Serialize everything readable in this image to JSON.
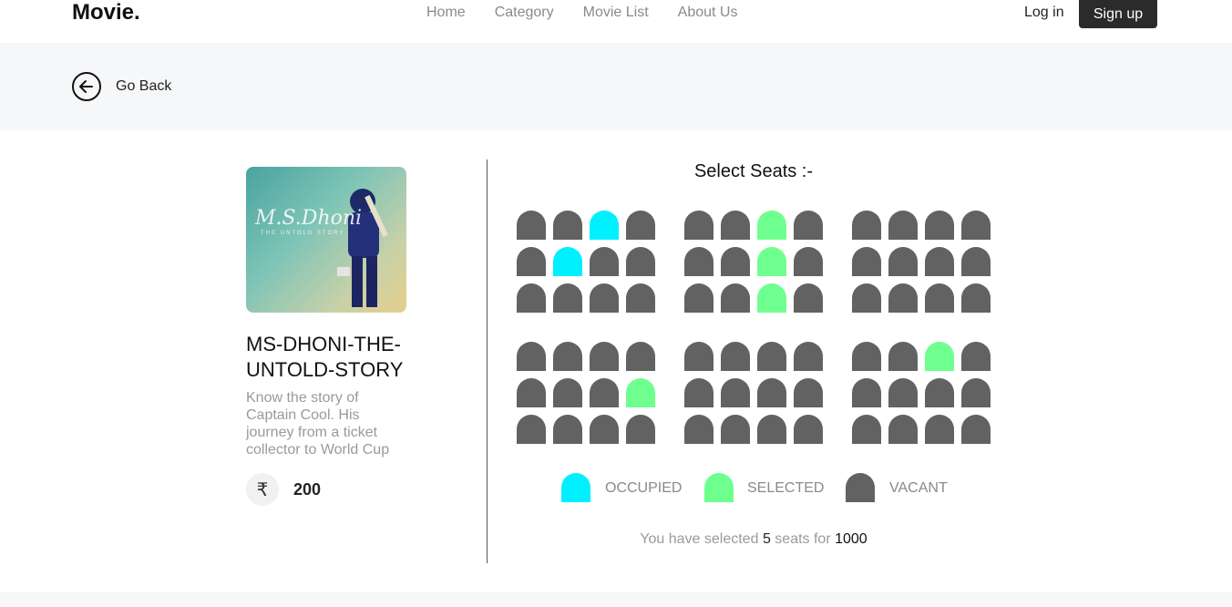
{
  "navbar": {
    "brand": "Movie.",
    "links": [
      "Home",
      "Category",
      "Movie List",
      "About Us"
    ],
    "login": "Log in",
    "signup": "Sign up"
  },
  "back": {
    "label": "Go Back",
    "icon": "arrow-left-circle-icon"
  },
  "movie": {
    "poster_title": "M.S.Dhoni",
    "poster_subtitle": "THE UNTOLD STORY",
    "name": "MS-DHONI-THE-UNTOLD-STORY",
    "description": "Know the story of Captain Cool. His journey from a ticket collector to World Cup",
    "currency_symbol": "₹",
    "price": "200"
  },
  "seats": {
    "heading": "Select Seats :-",
    "blocks": [
      [
        "vacant",
        "vacant",
        "occupied",
        "vacant",
        "vacant",
        "occupied",
        "vacant",
        "vacant",
        "vacant",
        "vacant",
        "vacant",
        "vacant"
      ],
      [
        "vacant",
        "vacant",
        "selected",
        "vacant",
        "vacant",
        "vacant",
        "selected",
        "vacant",
        "vacant",
        "vacant",
        "selected",
        "vacant"
      ],
      [
        "vacant",
        "vacant",
        "vacant",
        "vacant",
        "vacant",
        "vacant",
        "vacant",
        "vacant",
        "vacant",
        "vacant",
        "vacant",
        "vacant"
      ],
      [
        "vacant",
        "vacant",
        "vacant",
        "vacant",
        "vacant",
        "vacant",
        "vacant",
        "selected",
        "vacant",
        "vacant",
        "vacant",
        "vacant"
      ],
      [
        "vacant",
        "vacant",
        "vacant",
        "vacant",
        "vacant",
        "vacant",
        "vacant",
        "vacant",
        "vacant",
        "vacant",
        "vacant",
        "vacant"
      ],
      [
        "vacant",
        "vacant",
        "selected",
        "vacant",
        "vacant",
        "vacant",
        "vacant",
        "vacant",
        "vacant",
        "vacant",
        "vacant",
        "vacant"
      ]
    ],
    "colors": {
      "occupied": "#00f0ff",
      "selected": "#6fff8f",
      "vacant": "#626262"
    }
  },
  "legend": {
    "occupied": "OCCUPIED",
    "selected": "SELECTED",
    "vacant": "VACANT"
  },
  "summary": {
    "prefix": "You have selected",
    "count": "5",
    "middle": "seats for",
    "total": "1000"
  }
}
